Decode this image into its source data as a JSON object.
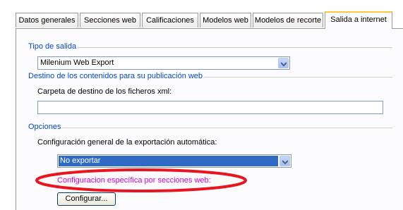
{
  "tabs": [
    {
      "label": "Datos generales"
    },
    {
      "label": "Secciones web"
    },
    {
      "label": "Calificaciones"
    },
    {
      "label": "Modelos web"
    },
    {
      "label": "Modelos de recorte"
    },
    {
      "label": "Salida a internet"
    }
  ],
  "tipo_salida": {
    "group_label": "Tipo de salida",
    "selected": "Milenium Web Export"
  },
  "destino": {
    "group_label": "Destino de los contenidos para su publicación web",
    "folder_label": "Carpeta de destino de los ficheros xml:",
    "folder_value": ""
  },
  "opciones": {
    "group_label": "Opciones",
    "config_label": "Configuración general de la exportación automática:",
    "config_selected": "No exportar",
    "specific_label": "Configuracion específica por secciones web:",
    "configure_button": "Configurar..."
  },
  "colors": {
    "group_label": "#0046d5",
    "specific_label": "#d200d2",
    "annotation_ellipse": "#e8141e",
    "selection": "#316ac5"
  },
  "icons": {
    "dropdown": "chevron-down-icon"
  }
}
